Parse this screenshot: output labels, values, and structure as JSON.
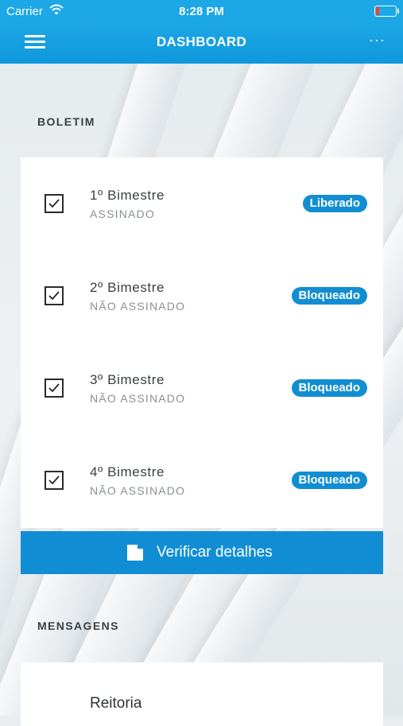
{
  "status_bar": {
    "carrier": "Carrier",
    "time": "8:28 PM"
  },
  "header": {
    "title": "DASHBOARD",
    "more": "···"
  },
  "boletim": {
    "section_label": "BOLETIM",
    "items": [
      {
        "title": "1º Bimestre",
        "subtitle": "ASSINADO",
        "badge": "Liberado"
      },
      {
        "title": "2º Bimestre",
        "subtitle": "NÃO ASSINADO",
        "badge": "Bloqueado"
      },
      {
        "title": "3º Bimestre",
        "subtitle": "NÃO ASSINADO",
        "badge": "Bloqueado"
      },
      {
        "title": "4º Bimestre",
        "subtitle": "NÃO ASSINADO",
        "badge": "Bloqueado"
      }
    ],
    "action_label": "Verificar detalhes"
  },
  "mensagens": {
    "section_label": "MENSAGENS",
    "items": [
      {
        "title": "Reitoria"
      }
    ]
  },
  "colors": {
    "header": "#1ca7e6",
    "accent": "#118ed3",
    "battery_low": "#ff3b30"
  },
  "icons": [
    "wifi-icon",
    "battery-icon",
    "hamburger-menu-icon",
    "more-icon",
    "checkbox-checked-icon",
    "edit-icon"
  ]
}
